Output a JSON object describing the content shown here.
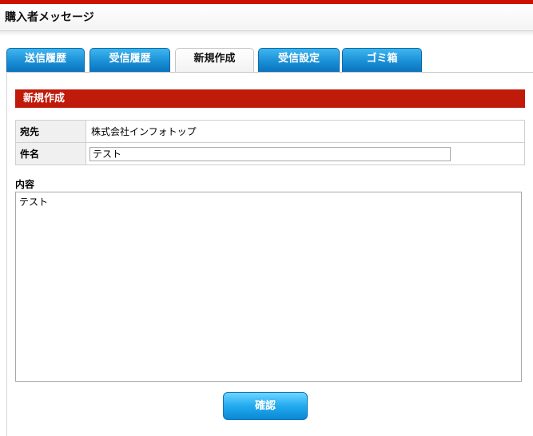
{
  "header": {
    "title": "購入者メッセージ"
  },
  "tabs": [
    {
      "label": "送信履歴",
      "active": false
    },
    {
      "label": "受信履歴",
      "active": false
    },
    {
      "label": "新規作成",
      "active": true
    },
    {
      "label": "受信設定",
      "active": false
    },
    {
      "label": "ゴミ箱",
      "active": false
    }
  ],
  "section": {
    "title": "新規作成"
  },
  "form": {
    "recipient_label": "宛先",
    "recipient_value": "株式会社インフォトップ",
    "subject_label": "件名",
    "subject_value": "テスト",
    "content_label": "内容",
    "content_value": "テスト"
  },
  "buttons": {
    "confirm_label": "確認"
  },
  "colors": {
    "brand_red": "#c01a0a",
    "tab_blue": "#1a8fd6"
  }
}
